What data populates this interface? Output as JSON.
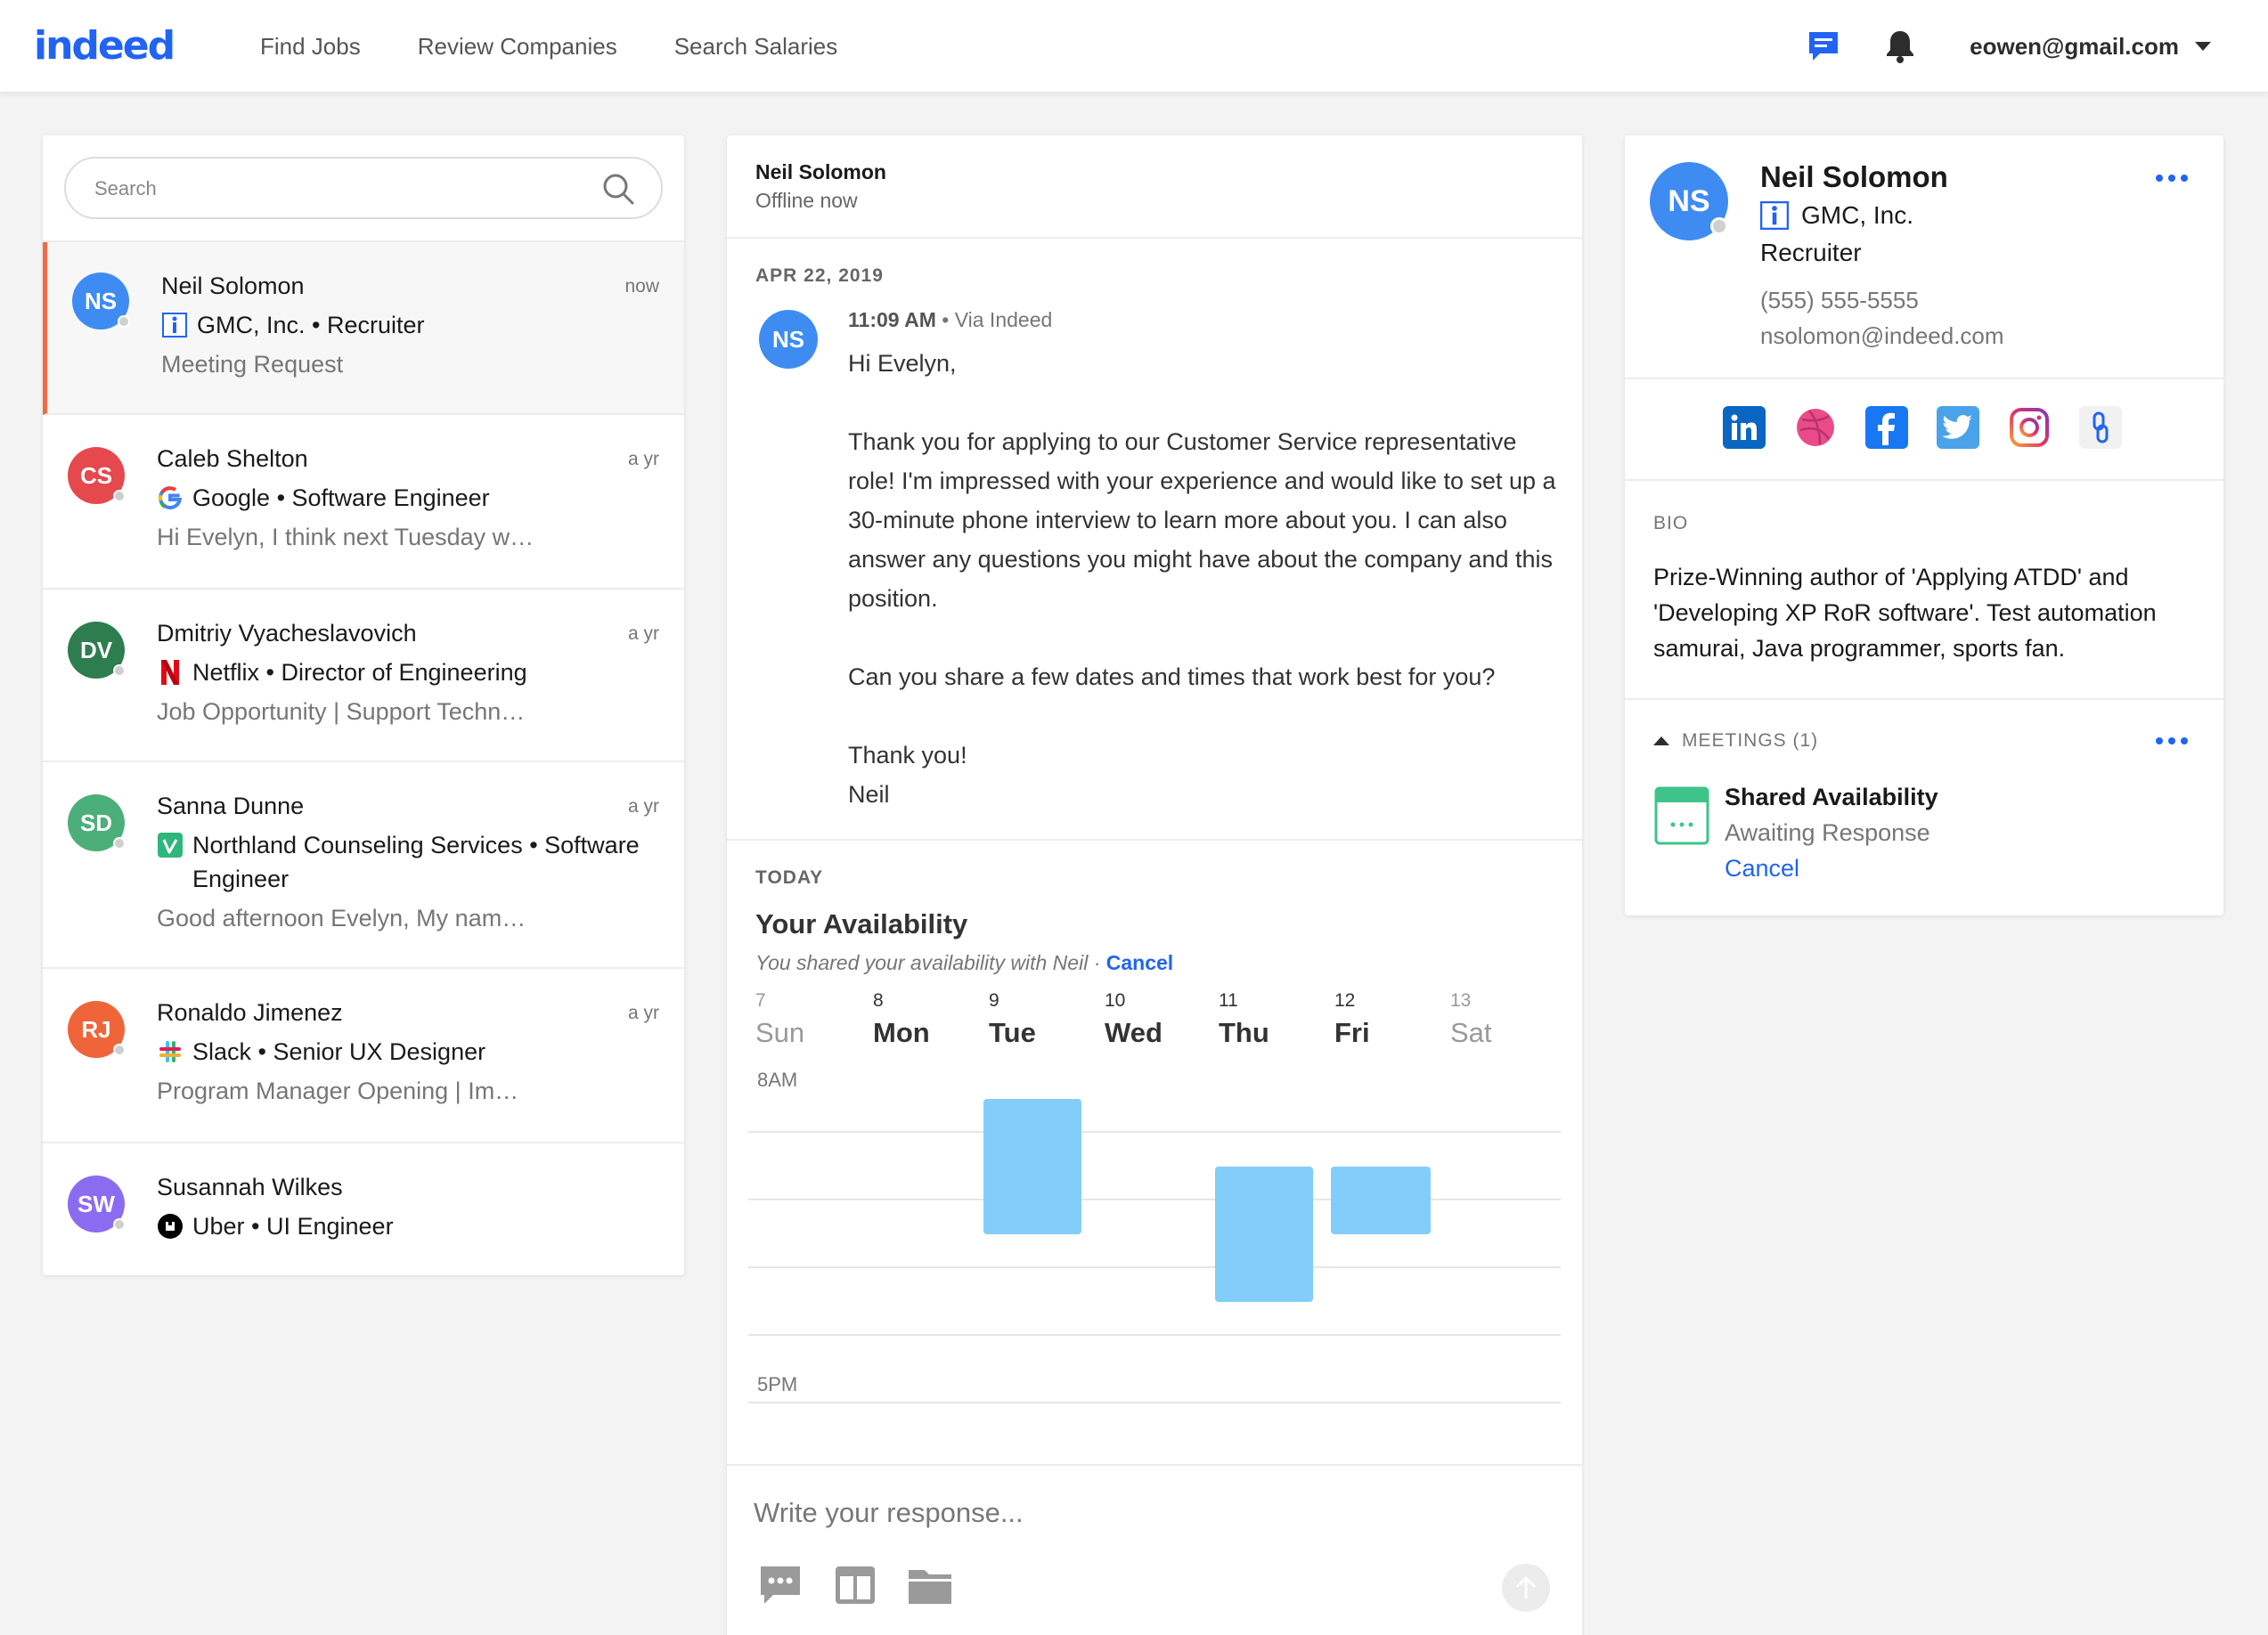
{
  "header": {
    "logo": "indeed",
    "nav": [
      "Find Jobs",
      "Review Companies",
      "Search Salaries"
    ],
    "account_email": "eowen@gmail.com"
  },
  "conversation_list": {
    "search_placeholder": "Search",
    "items": [
      {
        "initials": "NS",
        "name": "Neil Solomon",
        "company": "GMC, Inc. • Recruiter",
        "preview": "Meeting Request",
        "time": "now",
        "color": "#3e8cf2",
        "icon": "indeed-info-icon"
      },
      {
        "initials": "CS",
        "name": "Caleb Shelton",
        "company": "Google • Software Engineer",
        "preview": "Hi Evelyn, I think next Tuesday w…",
        "time": "a yr",
        "color": "#e5484d",
        "icon": "google-icon"
      },
      {
        "initials": "DV",
        "name": "Dmitriy Vyacheslavovich",
        "company": "Netflix • Director of Engineering",
        "preview": "Job Opportunity | Support Techn…",
        "time": "a yr",
        "color": "#2e7d4f",
        "icon": "netflix-icon"
      },
      {
        "initials": "SD",
        "name": "Sanna Dunne",
        "company": "Northland Counseling Services • Software Engineer",
        "preview": "Good afternoon Evelyn, My nam…",
        "time": "a yr",
        "color": "#4caf7a",
        "icon": "vine-icon"
      },
      {
        "initials": "RJ",
        "name": "Ronaldo Jimenez",
        "company": "Slack • Senior UX Designer",
        "preview": "Program Manager Opening | Im…",
        "time": "a yr",
        "color": "#f0643a",
        "icon": "slack-icon"
      },
      {
        "initials": "SW",
        "name": "Susannah Wilkes",
        "company": "Uber • UI Engineer",
        "preview": "",
        "time": "",
        "color": "#8b6cf0",
        "icon": "uber-icon"
      }
    ]
  },
  "thread": {
    "name": "Neil Solomon",
    "status": "Offline now",
    "date": "APR 22, 2019",
    "avatar": "NS",
    "time": "11:09 AM",
    "via": "• Via Indeed",
    "body": [
      "Hi Evelyn,",
      "Thank you for applying to our Customer Service representative role! I'm impressed with your experience and would like to set up a 30-minute phone interview to learn more about you. I can also answer any questions you might have about the company and this position.",
      "Can you share a few dates and times that work best for you?",
      "Thank you!",
      "Neil"
    ],
    "today_label": "TODAY",
    "availability_title": "Your Availability",
    "availability_sub": "You shared your availability with Neil · ",
    "availability_cancel": "Cancel",
    "days": [
      {
        "num": "7",
        "name": "Sun",
        "muted": true
      },
      {
        "num": "8",
        "name": "Mon",
        "muted": false
      },
      {
        "num": "9",
        "name": "Tue",
        "muted": false
      },
      {
        "num": "10",
        "name": "Wed",
        "muted": false
      },
      {
        "num": "11",
        "name": "Thu",
        "muted": false
      },
      {
        "num": "12",
        "name": "Fri",
        "muted": false
      },
      {
        "num": "13",
        "name": "Sat",
        "muted": true
      }
    ],
    "start_label": "8AM",
    "end_label": "5PM",
    "compose_placeholder": "Write your response..."
  },
  "profile": {
    "initials": "NS",
    "name": "Neil Solomon",
    "company": "GMC, Inc.",
    "role": "Recruiter",
    "phone": "(555) 555-5555",
    "email": "nsolomon@indeed.com",
    "socials": [
      "linkedin-icon",
      "dribbble-icon",
      "facebook-icon",
      "twitter-icon",
      "instagram-icon",
      "link-icon"
    ],
    "bio_label": "BIO",
    "bio": "Prize-Winning author of 'Applying ATDD' and 'Developing XP RoR software'. Test automation samurai, Java programmer, sports fan.",
    "meetings_label": "MEETINGS (1)",
    "meeting_title": "Shared Availability",
    "meeting_status": "Awaiting Response",
    "meeting_cancel": "Cancel"
  },
  "colors": {
    "brand": "#2164f3",
    "active_accent": "#f46942",
    "slot": "#82cdfa"
  }
}
